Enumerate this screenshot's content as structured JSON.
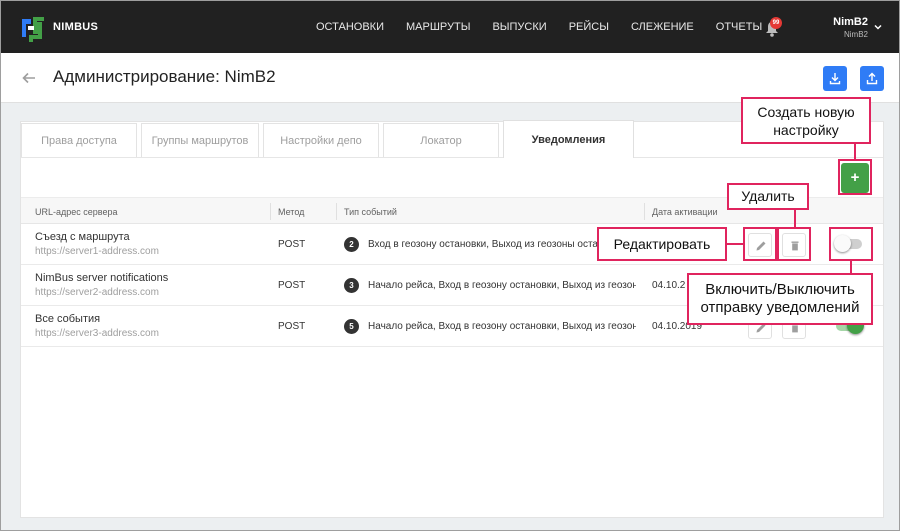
{
  "app": {
    "brand": "NIMBUS"
  },
  "nav": [
    "ОСТАНОВКИ",
    "МАРШРУТЫ",
    "ВЫПУСКИ",
    "РЕЙСЫ",
    "СЛЕЖЕНИЕ",
    "ОТЧЕТЫ"
  ],
  "notifications": {
    "count": "99"
  },
  "user": {
    "name": "NimB2",
    "sub": "NimB2"
  },
  "page": {
    "title": "Администрирование: NimB2"
  },
  "tabs": [
    {
      "label": "Права доступа"
    },
    {
      "label": "Группы маршрутов"
    },
    {
      "label": "Настройки депо"
    },
    {
      "label": "Локатор"
    },
    {
      "label": "Уведомления",
      "active": true
    }
  ],
  "add_button": {
    "label": "+"
  },
  "table": {
    "headers": {
      "url": "URL-адрес сервера",
      "method": "Метод",
      "events": "Тип событий",
      "date": "Дата активации"
    },
    "rows": [
      {
        "name": "Съезд с маршрута",
        "url": "https://server1-address.com",
        "method": "POST",
        "count": "2",
        "events": "Вход в геозону остановки, Выход из геозоны остановки",
        "date": "",
        "enabled": false
      },
      {
        "name": "NimBus server notifications",
        "url": "https://server2-address.com",
        "method": "POST",
        "count": "3",
        "events": "Начало рейса, Вход в геозону остановки, Выход из геозоны остановки",
        "date": "04.10.2",
        "enabled": false
      },
      {
        "name": "Все события",
        "url": "https://server3-address.com",
        "method": "POST",
        "count": "5",
        "events": "Начало рейса, Вход в геозону остановки, Выход из геозоны остановки",
        "date": "04.10.2019",
        "enabled": true
      }
    ]
  },
  "callouts": {
    "create": "Создать новую настройку",
    "delete": "Удалить",
    "edit": "Редактировать",
    "toggle": "Включить/Выключить отправку уведомлений"
  },
  "colors": {
    "topbar": "#212121",
    "primary": "#2f7cf6",
    "success": "#43a047",
    "callout": "#e0245e"
  },
  "icons": [
    "logo-icon",
    "bell-icon",
    "chevron-down-icon",
    "back-arrow-icon",
    "download-icon",
    "upload-icon",
    "pencil-icon",
    "trash-icon"
  ]
}
